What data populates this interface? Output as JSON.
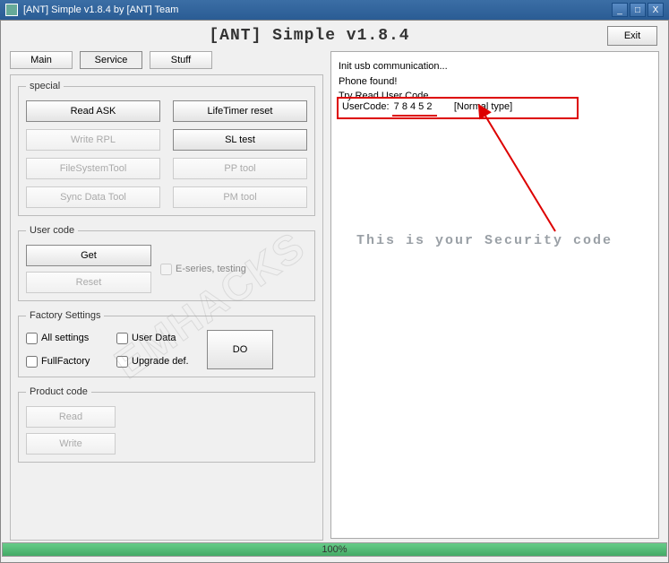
{
  "titlebar": {
    "text": "[ANT] Simple v1.8.4 by [ANT] Team"
  },
  "header": {
    "title": "[ANT] Simple v1.8.4",
    "exit": "Exit"
  },
  "tabs": {
    "main": "Main",
    "service": "Service",
    "stuff": "Stuff"
  },
  "special": {
    "legend": "special",
    "readask": "Read ASK",
    "lifetimer": "LifeTimer reset",
    "writerpl": "Write RPL",
    "sltest": "SL test",
    "fstool": "FileSystemTool",
    "pptool": "PP tool",
    "syncdata": "Sync Data Tool",
    "pmtool": "PM tool"
  },
  "usercode": {
    "legend": "User code",
    "get": "Get",
    "reset": "Reset",
    "eseries": "E-series, testing"
  },
  "factory": {
    "legend": "Factory Settings",
    "allsettings": "All settings",
    "userdata": "User Data",
    "fullfactory": "FullFactory",
    "upgradedef": "Upgrade def.",
    "do": "DO"
  },
  "product": {
    "legend": "Product code",
    "read": "Read",
    "write": "Write"
  },
  "log": {
    "line1": "Init usb communication...",
    "line2": "Phone found!",
    "line3": "Try Read User Code",
    "codeLabel": "UserCode:",
    "codeValue": " 7 8 4 5 2",
    "codeType": "[Normal type]"
  },
  "annotation": "This is your Security code",
  "watermark": "EMHACKS",
  "progress": {
    "percent": "100%",
    "width": "100%"
  }
}
